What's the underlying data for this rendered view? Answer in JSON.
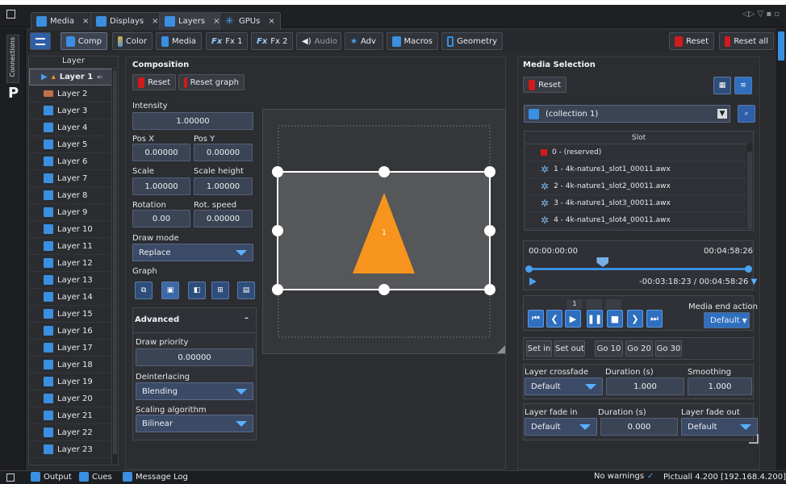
{
  "tabs": [
    {
      "label": "Media",
      "icon": "media-icon"
    },
    {
      "label": "Displays",
      "icon": "display-icon"
    },
    {
      "label": "Layers",
      "icon": "layers-icon"
    },
    {
      "label": "GPUs",
      "icon": "gpu-icon"
    }
  ],
  "side_tab": {
    "label": "Connections",
    "letter": "P"
  },
  "toolbar": {
    "items": [
      "Comp",
      "Color",
      "Media",
      "Fx 1",
      "Fx 2",
      "Audio",
      "Adv",
      "Macros",
      "Geometry"
    ],
    "reset": "Reset",
    "reset_all": "Reset all",
    "fx_prefix": "Fx"
  },
  "layers": {
    "header": "Layer",
    "items": [
      "Layer 1",
      "Layer 2",
      "Layer 3",
      "Layer 4",
      "Layer 5",
      "Layer 6",
      "Layer 7",
      "Layer 8",
      "Layer 9",
      "Layer 10",
      "Layer 11",
      "Layer 12",
      "Layer 13",
      "Layer 14",
      "Layer 15",
      "Layer 16",
      "Layer 17",
      "Layer 18",
      "Layer 19",
      "Layer 20",
      "Layer 21",
      "Layer 22",
      "Layer 23"
    ]
  },
  "composition": {
    "title": "Composition",
    "reset": "Reset",
    "reset_graph": "Reset graph",
    "intensity_label": "Intensity",
    "intensity": "1.00000",
    "posx_label": "Pos X",
    "posx": "0.00000",
    "posy_label": "Pos Y",
    "posy": "0.00000",
    "scale_label": "Scale",
    "scale": "1.00000",
    "scale_height_label": "Scale height",
    "scale_height": "1.00000",
    "rotation_label": "Rotation",
    "rotation": "0.00",
    "rot_speed_label": "Rot. speed",
    "rot_speed": "0.00000",
    "draw_mode_label": "Draw mode",
    "draw_mode": "Replace",
    "graph_label": "Graph",
    "advanced": "Advanced",
    "advanced_toggle": "–",
    "draw_priority_label": "Draw priority",
    "draw_priority": "0.00000",
    "deinterlacing_label": "Deinterlacing",
    "deinterlacing": "Blending",
    "scaling_label": "Scaling algorithm",
    "scaling": "Bilinear",
    "preview_number": "1"
  },
  "media": {
    "title": "Media Selection",
    "reset": "Reset",
    "collection": "(collection 1)",
    "slot_header": "Slot",
    "slots": [
      "0 - (reserved)",
      "1 - 4k-nature1_slot1_00011.awx",
      "2 - 4k-nature1_slot2_00011.awx",
      "3 - 4k-nature1_slot3_00011.awx",
      "4 - 4k-nature1_slot4_00011.awx"
    ],
    "time_start": "00:00:00:00",
    "time_end": "00:04:58:26",
    "timecode": "-00:03:18:23 / 00:04:58:26",
    "playhead": 0.335,
    "counter": "1",
    "end_action_label": "Media end action",
    "end_action": "Default",
    "set_in": "Set in",
    "set_out": "Set out",
    "go10": "Go 10",
    "go20": "Go 20",
    "go30": "Go 30",
    "crossfade_label": "Layer crossfade",
    "crossfade": "Default",
    "duration_label": "Duration (s)",
    "duration": "1.000",
    "smoothing_label": "Smoothing",
    "smoothing": "1.000",
    "fadein_label": "Layer fade in",
    "fadein": "Default",
    "fade_duration_label": "Duration (s)",
    "fade_duration": "0.000",
    "fadeout_label": "Layer fade out",
    "fadeout": "Default"
  },
  "status": {
    "output": "Output",
    "cues": "Cues",
    "message_log": "Message Log",
    "warnings": "No warnings",
    "server": "Pictuall 4.200 [192.168.4.200]"
  },
  "colors": {
    "accent_blue": "#3a8fe0",
    "reset_red": "#d21a1a",
    "triangle_orange": "#f7941d"
  }
}
